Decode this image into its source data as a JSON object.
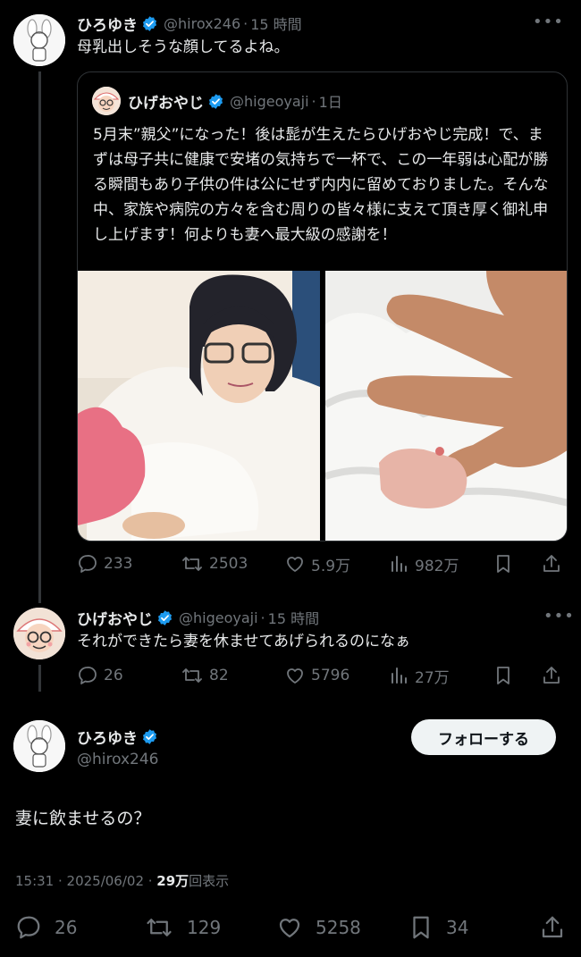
{
  "tweet1": {
    "name": "ひろゆき",
    "handle": "@hirox246",
    "dot": "·",
    "time": "15 時間",
    "text": "母乳出しそうな顔してるよね。",
    "more": "•••"
  },
  "quote": {
    "name": "ひげおやじ",
    "handle": "@higeoyaji",
    "dot": "·",
    "time": "1日",
    "text": "5月末”親父”になった！後は髭が生えたらひげおやじ完成！で、まずは母子共に健康で安堵の気持ちで一杯で、この一年弱は心配が勝る瞬間もあり子供の件は公にせず内内に留めておりました。そんな中、家族や病院の方々を含む周りの皆々様に支えて頂き厚く御礼申し上げます！何よりも妻へ最大級の感謝を！"
  },
  "tweet1_actions": {
    "replies": "233",
    "retweets": "2503",
    "likes": "5.9万",
    "views": "982万"
  },
  "reply": {
    "name": "ひげおやじ",
    "handle": "@higeoyaji",
    "dot": "·",
    "time": "15 時間",
    "text": "それができたら妻を休ませてあげられるのになぁ",
    "more": "•••"
  },
  "reply_actions": {
    "replies": "26",
    "retweets": "82",
    "likes": "5796",
    "views": "27万"
  },
  "main": {
    "name": "ひろゆき",
    "handle": "@hirox246",
    "follow_label": "フォローする",
    "text": "妻に飲ませるの？",
    "timestamp": "15:31 · 2025/06/02 · ",
    "views_count": "29万",
    "views_label": "回表示"
  },
  "main_actions": {
    "replies": "26",
    "retweets": "129",
    "likes": "5258",
    "bookmarks": "34"
  },
  "colors": {
    "background": "#000000",
    "verified": "#1d9bf0",
    "muted": "#71767b",
    "text": "#e7e9ea"
  }
}
